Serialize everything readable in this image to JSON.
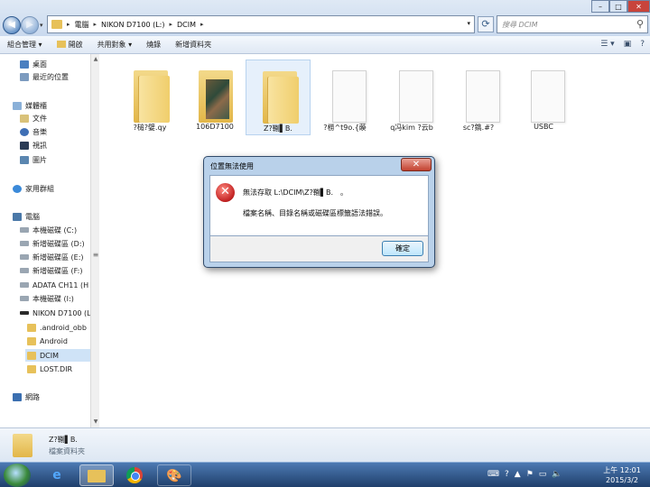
{
  "address": {
    "crumbs": [
      "電腦",
      "NIKON D7100 (L:)",
      "DCIM"
    ],
    "search_placeholder": "搜尋 DCIM",
    "back_icon": "back-arrow-icon",
    "forward_icon": "forward-arrow-icon"
  },
  "toolbar": {
    "organize": "組合管理 ▾",
    "open": "開啟",
    "share": "共用對象 ▾",
    "burn": "燒錄",
    "new_folder": "新增資料夾"
  },
  "nav": {
    "favorites": [
      "桌面",
      "最近的位置"
    ],
    "libraries_title": "媒體櫃",
    "libraries": [
      "文件",
      "音樂",
      "視訊",
      "圖片"
    ],
    "homegroup": "家用群組",
    "computer_title": "電腦",
    "drives": [
      "本機磁碟 (C:)",
      "新增磁碟區 (D:)",
      "新增磁碟區 (E:)",
      "新增磁碟區 (F:)",
      "ADATA CH11 (H",
      "本機磁碟 (I:)",
      "NIKON D7100 (L"
    ],
    "camera_folders": [
      ".android_obb",
      "Android",
      "DCIM",
      "LOST.DIR"
    ],
    "network": "網路"
  },
  "items": [
    {
      "label": "?槌?嬖.qy",
      "kind": "folder"
    },
    {
      "label": "106D7100",
      "kind": "photo-folder"
    },
    {
      "label": "Z?鞩▌B.",
      "kind": "folder"
    },
    {
      "label": "?橯^t9o.{藈",
      "kind": "file"
    },
    {
      "label": "q冯kim ?云b",
      "kind": "file"
    },
    {
      "label": "sc?鐫.#?",
      "kind": "file"
    },
    {
      "label": "USBC",
      "kind": "file"
    }
  ],
  "details": {
    "name": "Z?鞩▌B.",
    "type": "檔案資料夾"
  },
  "dialog": {
    "title": "位置無法使用",
    "message1": "無法存取 L:\\DCIM\\Z?鞩▌B.　。",
    "message2": "檔案名稱、目錄名稱或磁碟區標籤語法錯誤。",
    "ok": "確定",
    "close": "✕"
  },
  "clock": {
    "time": "上午 12:01",
    "date": "2015/3/2"
  },
  "colors": {
    "accent": "#3c7fb1",
    "error": "#c62828",
    "folder": "#e7c15a"
  }
}
